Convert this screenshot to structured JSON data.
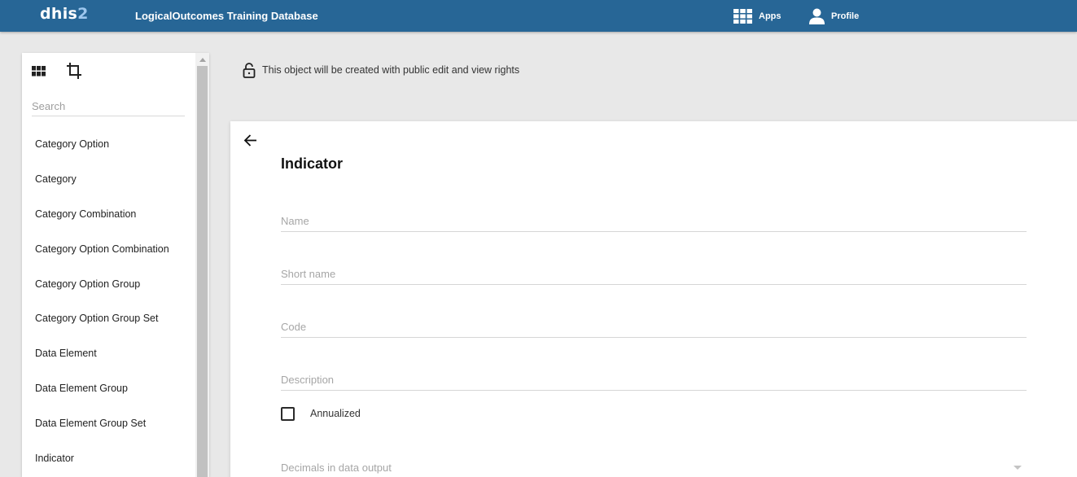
{
  "header": {
    "logo_main": "dhis",
    "logo_num": "2",
    "db_title": "LogicalOutcomes Training Database",
    "apps_label": "Apps",
    "profile_label": "Profile"
  },
  "sidebar": {
    "search_placeholder": "Search",
    "items": [
      {
        "label": "Category Option"
      },
      {
        "label": "Category"
      },
      {
        "label": "Category Combination"
      },
      {
        "label": "Category Option Combination"
      },
      {
        "label": "Category Option Group"
      },
      {
        "label": "Category Option Group Set"
      },
      {
        "label": "Data Element"
      },
      {
        "label": "Data Element Group"
      },
      {
        "label": "Data Element Group Set"
      },
      {
        "label": "Indicator"
      }
    ]
  },
  "notice": {
    "text": "This object will be created with public edit and view rights"
  },
  "form": {
    "title": "Indicator",
    "name_placeholder": "Name",
    "short_name_placeholder": "Short name",
    "code_placeholder": "Code",
    "description_placeholder": "Description",
    "annualized_label": "Annualized",
    "annualized_checked": false,
    "decimals_placeholder": "Decimals in data output"
  },
  "colors": {
    "header_bg": "#276696",
    "page_bg": "#e8e8e8",
    "logo_accent": "#9dc7ee"
  }
}
